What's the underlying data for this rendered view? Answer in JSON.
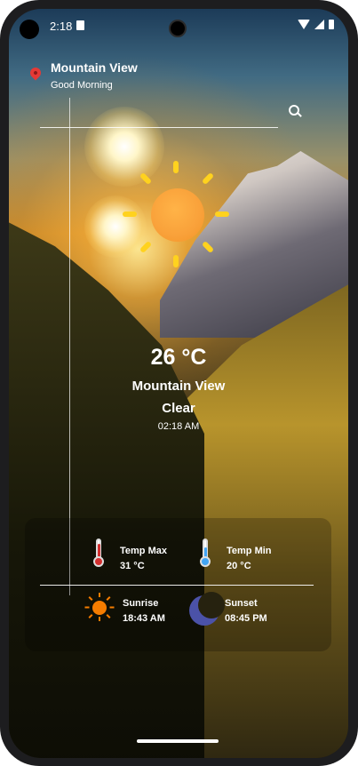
{
  "status_bar": {
    "time": "2:18"
  },
  "header": {
    "city": "Mountain View",
    "greeting": "Good Morning"
  },
  "weather": {
    "temperature": "26 °C",
    "city": "Mountain View",
    "condition": "Clear",
    "local_time": "02:18 AM"
  },
  "details": {
    "temp_max_label": "Temp Max",
    "temp_max_value": "31 °C",
    "temp_min_label": "Temp Min",
    "temp_min_value": "20 °C",
    "sunrise_label": "Sunrise",
    "sunrise_value": "18:43 AM",
    "sunset_label": "Sunset",
    "sunset_value": "08:45 PM"
  },
  "colors": {
    "pin": "#e53935",
    "sun": "#f9a13a",
    "sun_rays": "#ffd21e",
    "thermo_max": "#d32f2f",
    "thermo_min": "#42a5f5",
    "moon": "#4b52a8"
  }
}
